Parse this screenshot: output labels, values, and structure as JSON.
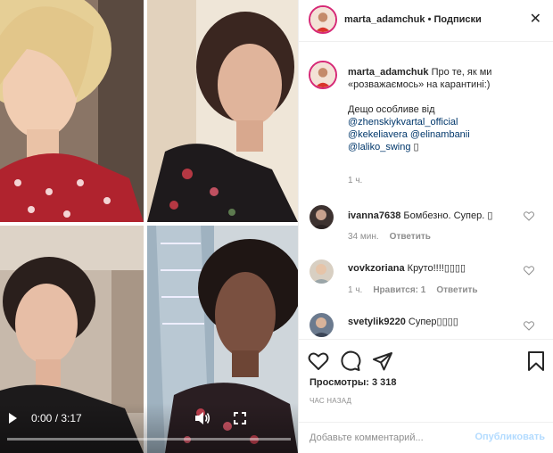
{
  "header": {
    "username": "marta_adamchuk",
    "separator": "•",
    "follow_label": "Подписки",
    "close_icon": "close-icon"
  },
  "caption": {
    "username": "marta_adamchuk",
    "text_line1": "Про те, як ми «розважаємось» на карантині:)",
    "text_line2": "Дещо особливе від",
    "mentions": [
      "@zhenskiykvartal_official",
      "@kekeliavera",
      "@elinambanii",
      "@laliko_swing"
    ],
    "emoji_box": "▯",
    "time": "1 ч."
  },
  "comments": [
    {
      "username": "ivanna7638",
      "text": "Бомбезно. Супер. ▯",
      "time": "34 мин.",
      "likes": "",
      "reply": "Ответить"
    },
    {
      "username": "vovkzoriana",
      "text": "Круто!!!!▯▯▯▯",
      "time": "1 ч.",
      "likes": "Нравится: 1",
      "reply": "Ответить"
    },
    {
      "username": "svetylik9220",
      "text": "Супер▯▯▯▯",
      "time": "",
      "likes": "",
      "reply": ""
    }
  ],
  "actions": {
    "likes_label": "Просмотры: 3 318",
    "date": "ЧАС НАЗАД",
    "comment_placeholder": "Добавьте комментарий...",
    "publish": "Опубликовать"
  },
  "video": {
    "time_display": "0:00 / 3:17",
    "progress": 0.0
  },
  "colors": {
    "accent": "#0095f6",
    "mention": "#00376b",
    "muted": "#8e8e8e",
    "publish_disabled": "#b3dbff"
  }
}
